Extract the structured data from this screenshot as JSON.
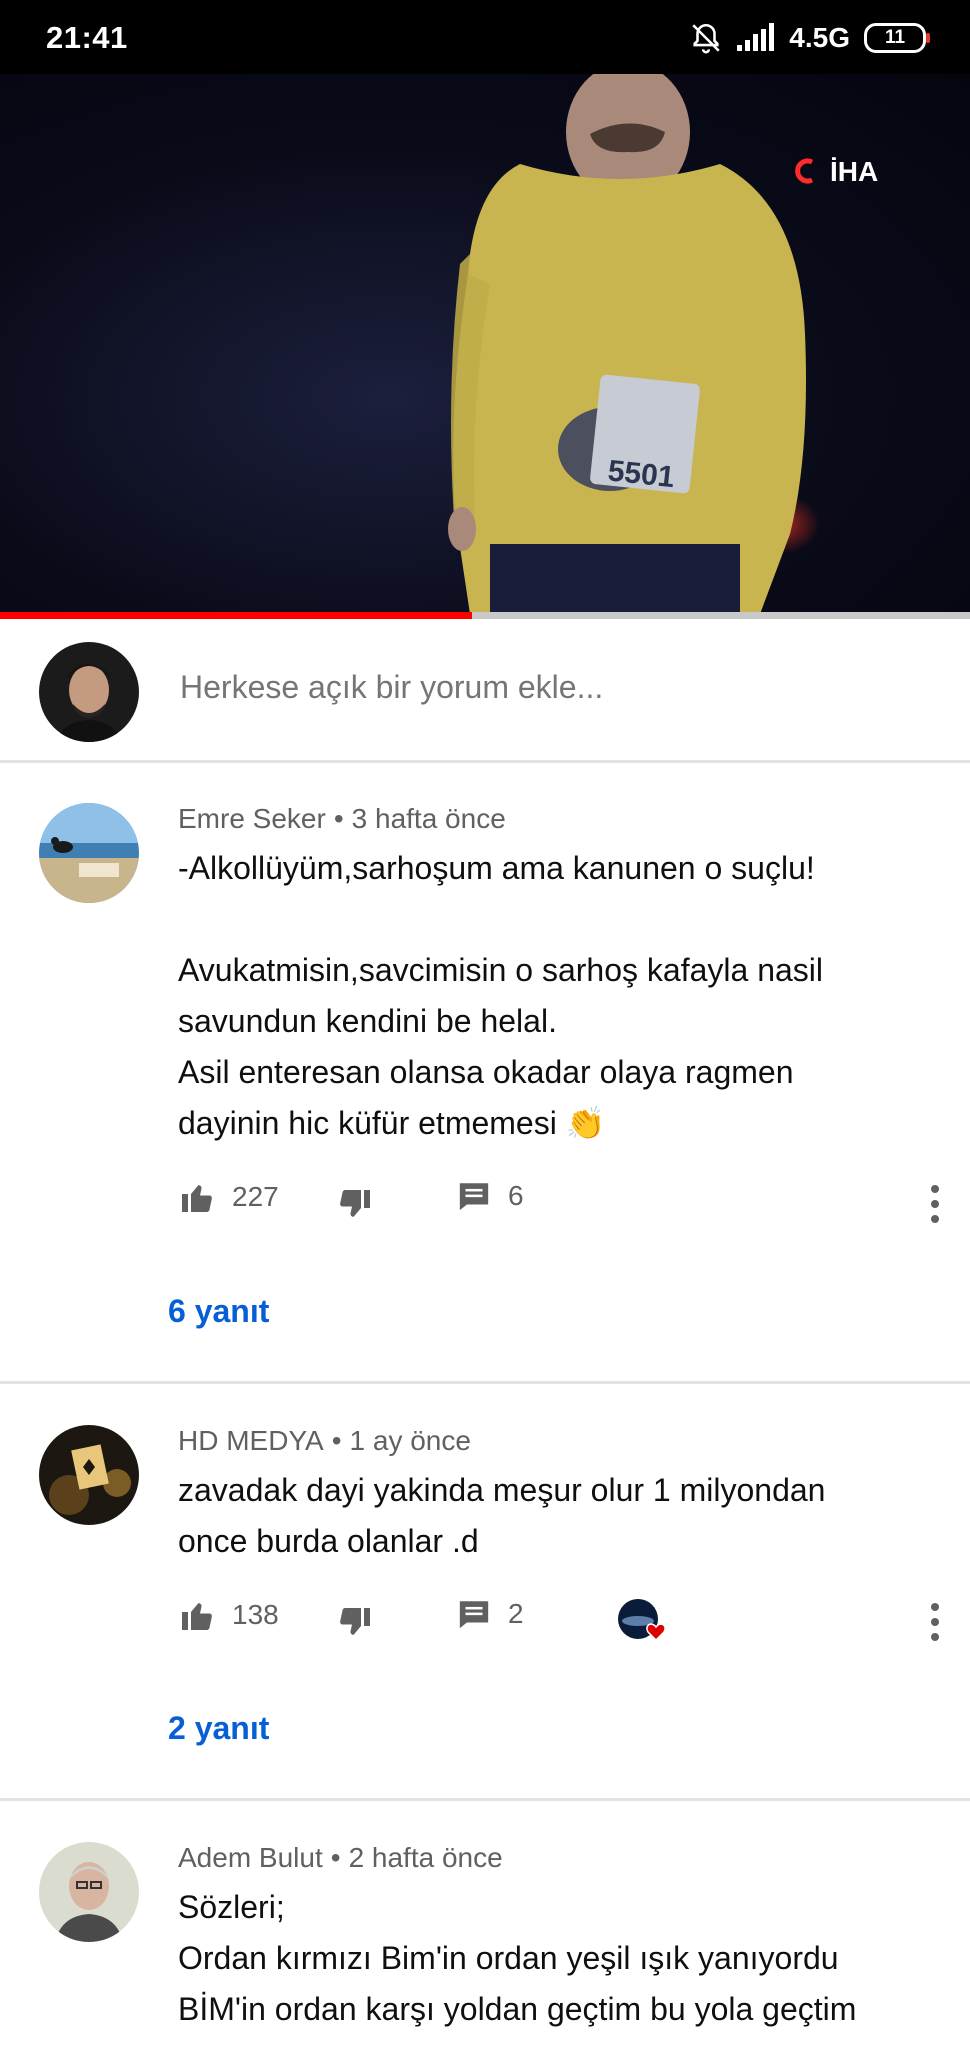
{
  "status_bar": {
    "time": "21:41",
    "network": "4.5G",
    "battery": "11",
    "icons": [
      "bell-off-icon",
      "signal-icon",
      "battery-icon"
    ]
  },
  "video": {
    "watermark": "İHA",
    "bib_number": "5501",
    "progress_fraction": 0.487
  },
  "compose": {
    "placeholder": "Herkese açık bir yorum ekle..."
  },
  "comments": [
    {
      "author": "Emre Seker",
      "time": "3 hafta önce",
      "lines": [
        "-Alkollüyüm,sarhoşum ama kanunen o suçlu!",
        "",
        "Avukatmisin,savcimisin o sarhoş kafayla nasil",
        "savundun kendini be helal.",
        "Asil enteresan olansa okadar olaya ragmen",
        "dayinin hic küfür etmemesi 👏"
      ],
      "likes": "227",
      "reply_count": "6",
      "replies_label": "6 yanıt"
    },
    {
      "author": "HD MEDYA",
      "time": "1 ay önce",
      "lines": [
        "zavadak dayi yakinda meşur olur 1 milyondan",
        "once burda olanlar .d"
      ],
      "likes": "138",
      "reply_count": "2",
      "replies_label": "2 yanıt",
      "creator_heart": true
    },
    {
      "author": "Adem Bulut",
      "time": "2 hafta önce",
      "lines": [
        "Sözleri;",
        "Ordan kırmızı Bim'in ordan yeşil ışık yanıyordu",
        "BİM'in ordan karşı yoldan geçtim bu yola geçtim"
      ]
    }
  ],
  "colors": {
    "accent_blue": "#065fd4",
    "progress_red": "#ff0000",
    "meta_gray": "#606060"
  }
}
